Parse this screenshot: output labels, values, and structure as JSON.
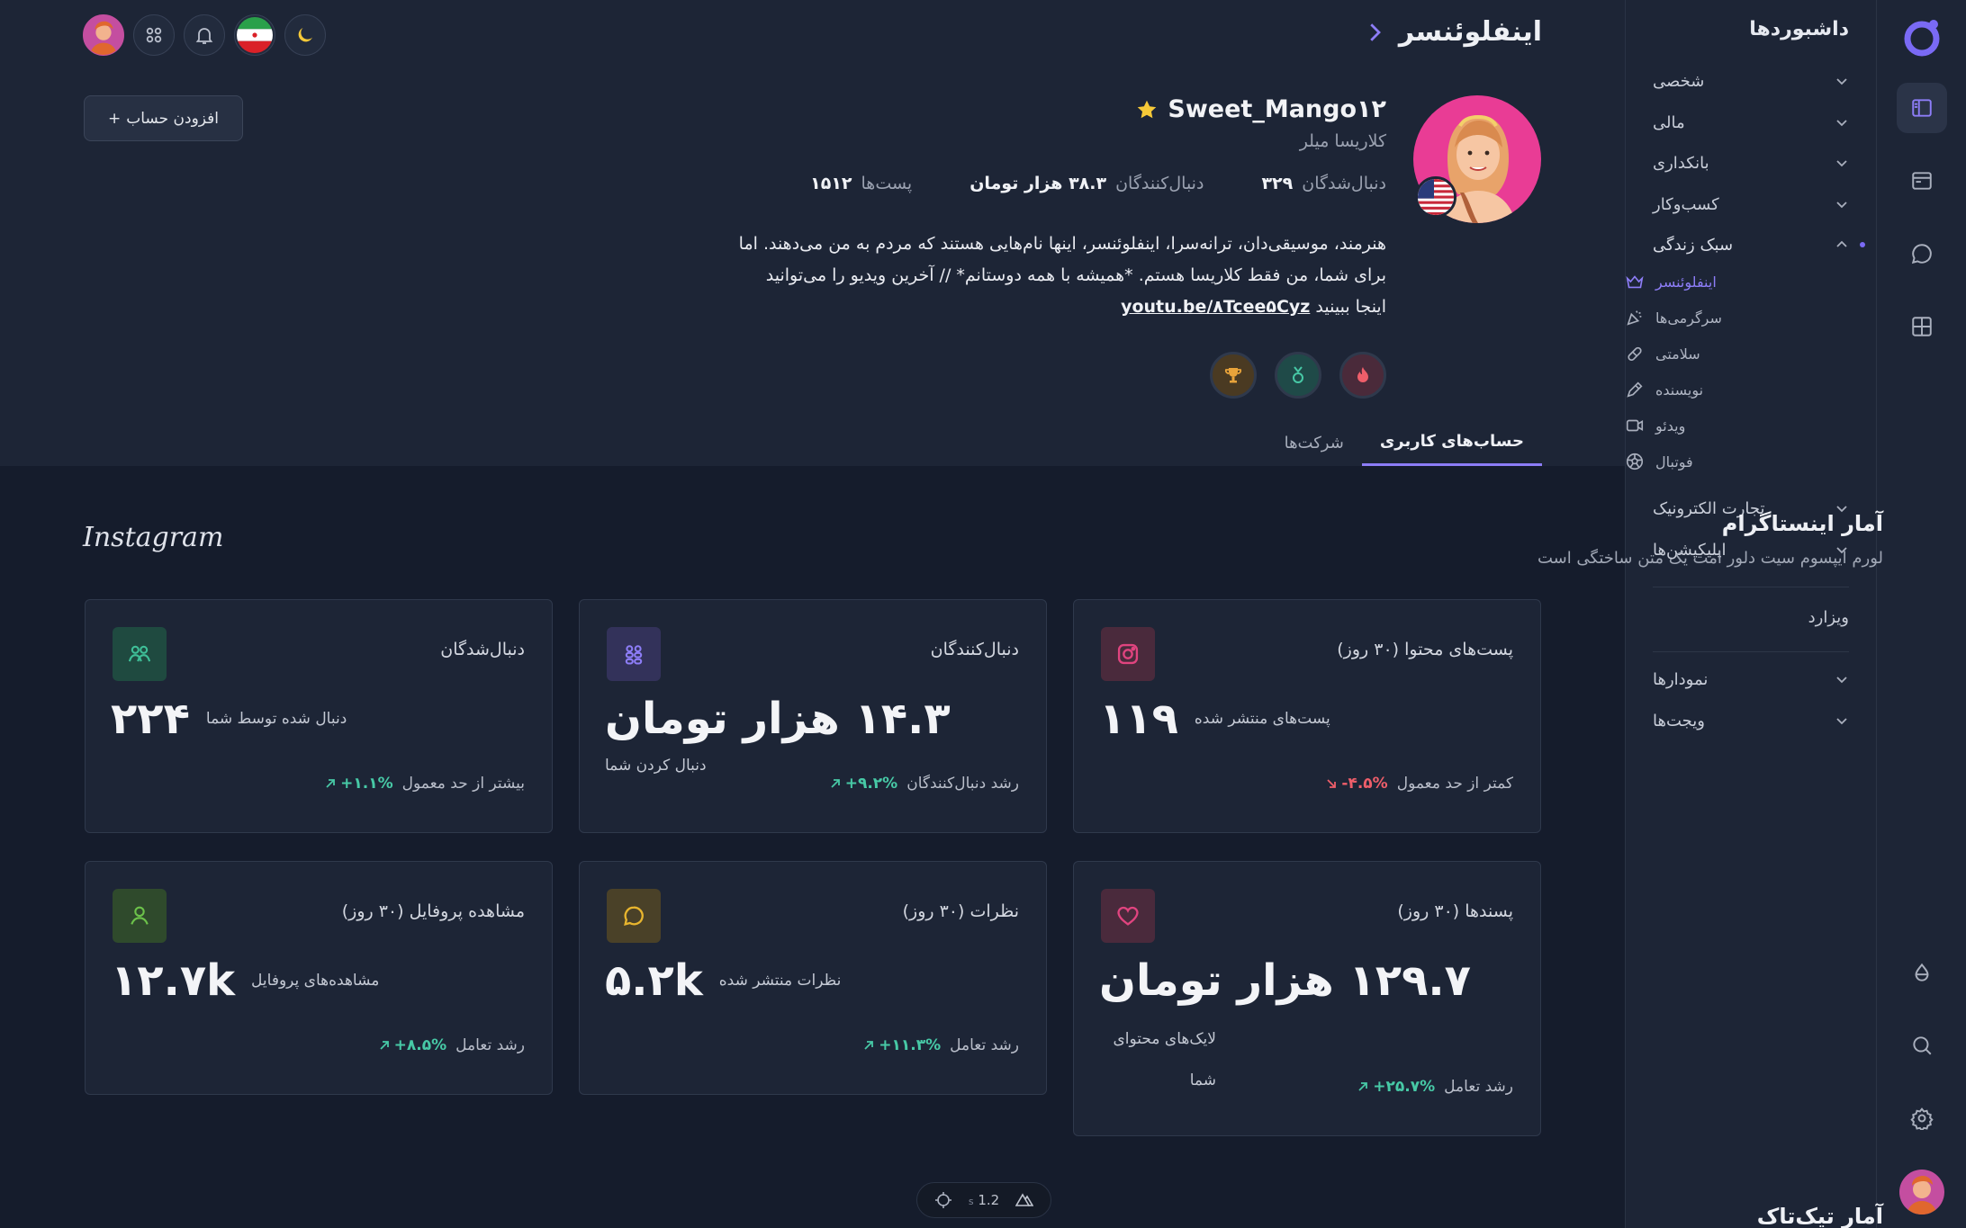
{
  "rail": {
    "items": [
      "layout-icon",
      "browser-icon",
      "chat-icon",
      "grid-icon"
    ],
    "bottom": [
      "drop-icon",
      "search-icon",
      "gear-icon"
    ]
  },
  "menu": {
    "title": "داشبوردها",
    "items": [
      {
        "label": "شخصی"
      },
      {
        "label": "مالی"
      },
      {
        "label": "بانکداری"
      },
      {
        "label": "کسب‌وکار"
      },
      {
        "label": "سبک زندگی"
      }
    ],
    "sub_items": [
      {
        "label": "اینفلوئنسر",
        "icon": "crown-icon"
      },
      {
        "label": "سرگرمی‌ها",
        "icon": "party-icon"
      },
      {
        "label": "سلامتی",
        "icon": "pill-icon"
      },
      {
        "label": "نویسنده",
        "icon": "pen-icon"
      },
      {
        "label": "ویدئو",
        "icon": "video-icon"
      },
      {
        "label": "فوتبال",
        "icon": "football-icon"
      }
    ],
    "items_after": [
      {
        "label": "تجارت الکترونیک"
      },
      {
        "label": "اپلیکیشن‌ها"
      }
    ],
    "wizard": "ویزارد",
    "items_bottom": [
      {
        "label": "نمودارها"
      },
      {
        "label": "ویجت‌ها"
      }
    ]
  },
  "header": {
    "title": "اینفلوئنسر",
    "add_account": "افزودن حساب"
  },
  "profile": {
    "username": "Sweet_Mango۱۲",
    "full_name": "کلاریسا میلر",
    "stats": [
      {
        "value": "۱۵۱۲",
        "label": "پست‌ها"
      },
      {
        "value": "۳۸.۳ هزار تومان",
        "label": "دنبال‌کنندگان"
      },
      {
        "value": "۳۲۹",
        "label": "دنبال‌شدگان"
      }
    ],
    "bio_line1": "هنرمند، موسیقی‌دان، ترانه‌سرا، اینفلوئنسر، اینها نام‌هایی هستند که مردم به من می‌دهند. اما",
    "bio_line2": "برای شما، من فقط کلاریسا هستم. *همیشه با همه دوستانم* // آخرین ویدیو را می‌توانید",
    "bio_line3_prefix": "اینجا ببینید",
    "bio_link": "youtu.be/۸Tcee۵Cyz"
  },
  "tabs": [
    {
      "label": "حساب‌های کاربری"
    },
    {
      "label": "شرکت‌ها"
    }
  ],
  "instagram": {
    "title": "آمار اینستاگرام",
    "subtitle": "لورم ایپسوم سیت دلور امت یک متن ساختگی است",
    "logo_text": "Instagram",
    "cards": [
      {
        "title": "پست‌های محتوا (۳۰ روز)",
        "value": "۱۱۹",
        "desc": "پست‌های منتشر شده",
        "pct": "-۴.۵%",
        "trend": "down",
        "foot": "کمتر از حد معمول",
        "icon": "instagram-icon",
        "color": "#e0447f"
      },
      {
        "title": "دنبال‌کنندگان",
        "value": "۱۴.۳ هزار تومان",
        "desc": "دنبال کردن شما",
        "pct": "+۹.۲%",
        "trend": "up",
        "foot": "رشد دنبال‌کنندگان",
        "icon": "users-group-icon",
        "color": "#7b6ef6"
      },
      {
        "title": "دنبال‌شدگان",
        "value": "۲۲۴",
        "desc": "دنبال شده توسط شما",
        "pct": "+۱.۱%",
        "trend": "up",
        "foot": "بیشتر از حد معمول",
        "icon": "users-icon",
        "color": "#3fbf98"
      },
      {
        "title": "پسندها (۳۰ روز)",
        "value": "۱۲۹.۷ هزار تومان",
        "desc": "لایک‌های محتوای شما",
        "pct": "+۲۵.۷%",
        "trend": "up",
        "foot": "رشد تعامل",
        "icon": "heart-icon",
        "color": "#e0447f"
      },
      {
        "title": "نظرات (۳۰ روز)",
        "value": "۵.۲k",
        "desc": "نظرات منتشر شده",
        "pct": "+۱۱.۳%",
        "trend": "up",
        "foot": "رشد تعامل",
        "icon": "comment-icon",
        "color": "#e8b52e"
      },
      {
        "title": "مشاهده پروفایل (۳۰ روز)",
        "value": "۱۲.۷k",
        "desc": "مشاهده‌های پروفایل",
        "pct": "+۸.۵%",
        "trend": "up",
        "foot": "رشد تعامل",
        "icon": "user-icon",
        "color": "#6cc24a"
      }
    ]
  },
  "tiktok": {
    "title": "آمار تیک‌تاک"
  },
  "devbar": {
    "value": "1.2",
    "unit": "s"
  }
}
